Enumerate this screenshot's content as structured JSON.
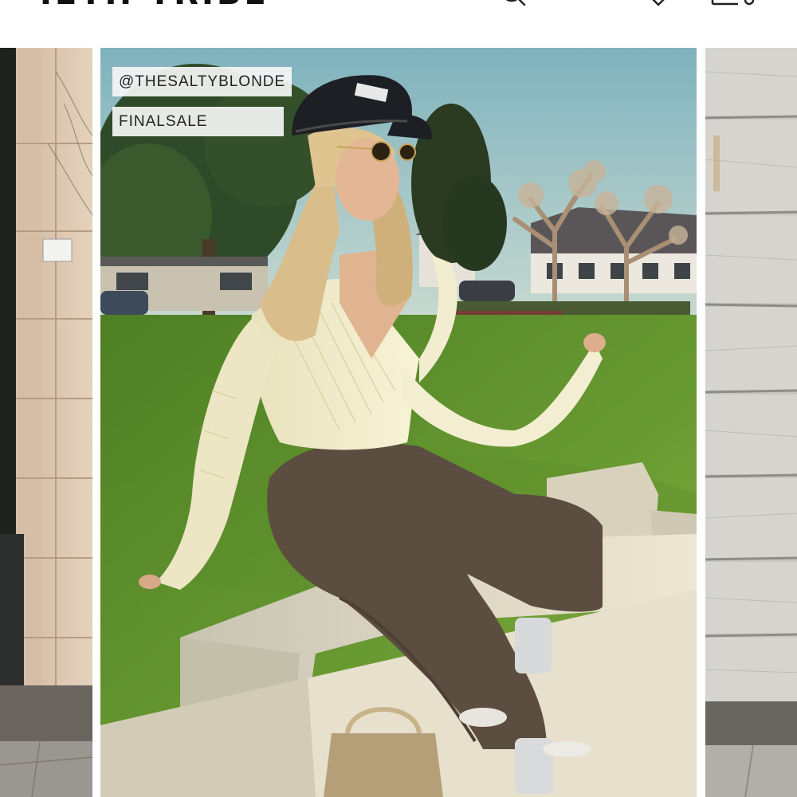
{
  "header": {
    "brand": "IETH TRIBE",
    "icons": [
      "search-icon",
      "heart-icon",
      "bag-icon"
    ]
  },
  "carousel": {
    "slides": [
      {
        "position": "previous",
        "image": "building-facade-photo"
      },
      {
        "position": "current",
        "image": "woman-sitting-on-bench-photo",
        "tags": [
          "@THESALTYBLONDE",
          "FINALSALE"
        ]
      },
      {
        "position": "next",
        "image": "wood-plank-wall-photo"
      }
    ]
  },
  "colors": {
    "sky": "#9fc3c8",
    "grass": "#5e8d2e",
    "sweater": "#f1ecc8",
    "pants": "#5d4f40",
    "bench": "#ddd8c6",
    "tag_bg": "#f5f5f5"
  }
}
